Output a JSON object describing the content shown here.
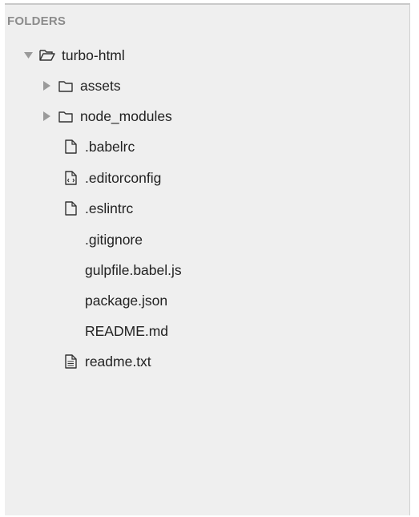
{
  "sidebar": {
    "header": "FOLDERS",
    "root": {
      "label": "turbo-html",
      "expanded": true,
      "icon": "folder-open-icon"
    },
    "items": [
      {
        "label": "assets",
        "type": "folder",
        "icon": "folder-icon"
      },
      {
        "label": "node_modules",
        "type": "folder",
        "icon": "folder-icon"
      },
      {
        "label": ".babelrc",
        "type": "file",
        "icon": "file-icon"
      },
      {
        "label": ".editorconfig",
        "type": "file",
        "icon": "code-file-icon"
      },
      {
        "label": ".eslintrc",
        "type": "file",
        "icon": "file-icon"
      },
      {
        "label": ".gitignore",
        "type": "file",
        "icon": ""
      },
      {
        "label": "gulpfile.babel.js",
        "type": "file",
        "icon": ""
      },
      {
        "label": "package.json",
        "type": "file",
        "icon": ""
      },
      {
        "label": "README.md",
        "type": "file",
        "icon": ""
      },
      {
        "label": "readme.txt",
        "type": "file",
        "icon": "text-file-icon"
      }
    ]
  },
  "colors": {
    "panel_background": "#efefef",
    "header_text": "#8c8c8c",
    "item_text": "#222222",
    "arrow": "#9a9a9a"
  }
}
